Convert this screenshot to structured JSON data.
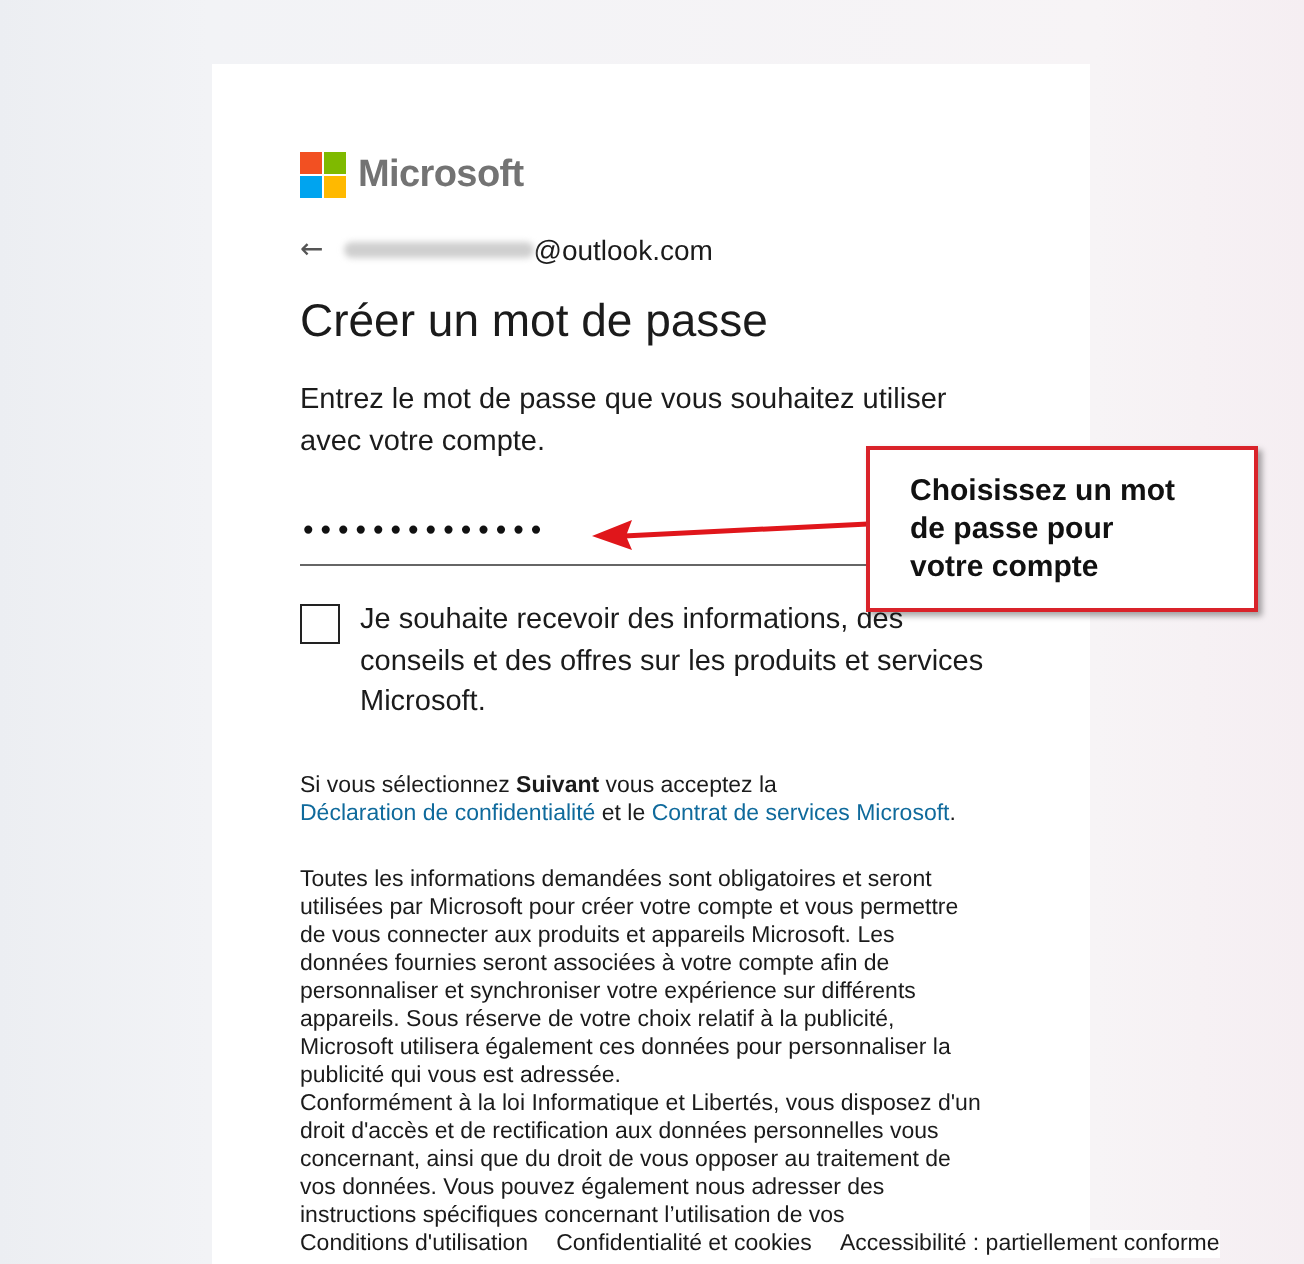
{
  "brand": "Microsoft",
  "account": {
    "back": "←",
    "email_suffix": "@outlook.com"
  },
  "title": "Créer un mot de passe",
  "instructions": "Entrez le mot de passe que vous souhaitez utiliser avec votre compte.",
  "password": {
    "value": "••••••••••••••"
  },
  "newsletter": {
    "checked": false,
    "label": "Je souhaite recevoir des informations, des conseils et des offres sur les produits et services Microsoft."
  },
  "consent": [
    {
      "kind": "text",
      "text": "Si vous sélectionnez **Suivant** vous acceptez la "
    },
    {
      "kind": "link",
      "text": "Déclaration de confidentialité"
    },
    {
      "kind": "text",
      "text": " et le "
    },
    {
      "kind": "link",
      "text": "Contrat de services Microsoft"
    },
    {
      "kind": "text",
      "text": "."
    }
  ],
  "legal": [
    "Toutes les informations demandées sont obligatoires et seront utilisées par Microsoft pour créer votre compte et vous permettre de vous connecter aux produits et appareils Microsoft. Les données fournies seront associées à votre compte afin de personnaliser et synchroniser votre expérience sur différents appareils. Sous réserve de votre choix relatif à la publicité, Microsoft utilisera également ces données pour personnaliser la publicité qui vous est adressée.",
    "Conformément à la loi Informatique et Libertés, vous disposez d'un droit d'accès et de rectification aux données personnelles vous concernant, ainsi que du droit de vous opposer au traitement de vos données. Vous pouvez également nous adresser des instructions spécifiques concernant l’utilisation de vos"
  ],
  "callout": {
    "text": "Choisissez un mot de passe pour votre compte"
  },
  "footer": [
    "Conditions d'utilisation",
    "Confidentialité et cookies",
    "Accessibilité : partiellement conforme"
  ]
}
